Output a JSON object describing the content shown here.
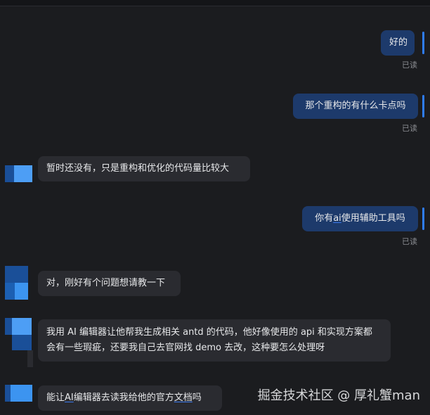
{
  "messages": [
    {
      "text": "好的",
      "status": "已读"
    },
    {
      "text": "那个重构的有什么卡点吗",
      "status": "已读"
    },
    {
      "text": "暂时还没有，只是重构和优化的代码量比较大"
    },
    {
      "text_pre": "你有",
      "text_link": "ai",
      "text_post": "使用辅助工具吗",
      "status": "已读"
    },
    {
      "text": "对，刚好有个问题想请教一下"
    },
    {
      "line1": "我用 AI 编辑器让他帮我生成相关 antd 的代码，他好像使用的 api 和实现方案都",
      "line2": "会有一些瑕疵，还要我自己去官网找 demo 去改，这种要怎么处理呀"
    },
    {
      "text_pre": "能让",
      "text_link": "AI",
      "text_mid": "编辑器去读我给他的官方",
      "text_link2": "文档",
      "text_post": "吗"
    }
  ],
  "watermark": "掘金技术社区 @ 厚礼蟹man",
  "colors": {
    "background": "#1b1c1f",
    "self_bubble": "#1d3a6b",
    "other_bubble": "#2a2b30",
    "accent": "#2f7cf6",
    "avatar_dark": "#1c5fb2",
    "avatar_light": "#3c94f0"
  }
}
